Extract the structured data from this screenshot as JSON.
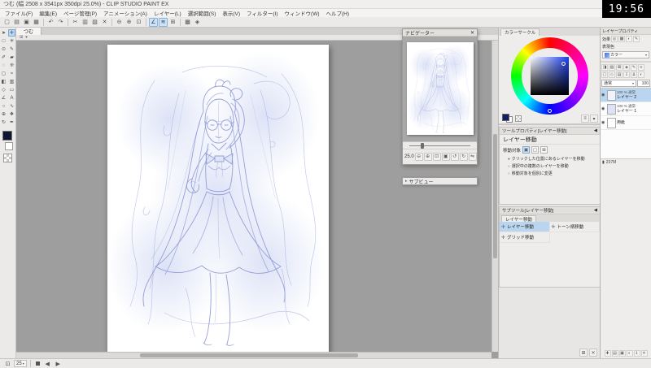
{
  "app": {
    "title": "つむ (幅 2508 x 3541px 350dpi 25.0%) - CLIP STUDIO PAINT EX",
    "clock": "19:56"
  },
  "menu": {
    "items": [
      "ファイル(F)",
      "編集(E)",
      "ページ管理(P)",
      "アニメーション(A)",
      "レイヤー(L)",
      "選択範囲(S)",
      "表示(V)",
      "フィルター(I)",
      "ウィンドウ(W)",
      "ヘルプ(H)"
    ]
  },
  "main_toolbar": {
    "icons": [
      {
        "name": "new-icon",
        "glyph": "▢"
      },
      {
        "name": "open-icon",
        "glyph": "▤"
      },
      {
        "name": "save-icon",
        "glyph": "▣"
      },
      {
        "name": "save-all-icon",
        "glyph": "▦"
      },
      {
        "type": "sep"
      },
      {
        "name": "undo-icon",
        "glyph": "↶"
      },
      {
        "name": "redo-icon",
        "glyph": "↷"
      },
      {
        "type": "sep"
      },
      {
        "name": "cut-icon",
        "glyph": "✂"
      },
      {
        "name": "copy-icon",
        "glyph": "▥"
      },
      {
        "name": "paste-icon",
        "glyph": "▧"
      },
      {
        "name": "delete-icon",
        "glyph": "✕"
      },
      {
        "type": "sep"
      },
      {
        "name": "zoom-out-icon",
        "glyph": "⊖"
      },
      {
        "name": "zoom-in-icon",
        "glyph": "⊕"
      },
      {
        "name": "fit-screen-icon",
        "glyph": "⊡"
      },
      {
        "type": "sep"
      },
      {
        "name": "snap-ruler-icon",
        "glyph": "∠",
        "active": true
      },
      {
        "name": "snap-special-ruler-icon",
        "glyph": "≋",
        "active": true
      },
      {
        "name": "snap-grid-icon",
        "glyph": "⊞"
      },
      {
        "type": "sep"
      },
      {
        "name": "grid-icon",
        "glyph": "▩"
      },
      {
        "name": "material-icon",
        "glyph": "◈"
      }
    ]
  },
  "tool_palette": {
    "foreground_color": "#101630",
    "background_color": "#ffffff",
    "tools": [
      {
        "name": "operation-tool",
        "glyph": "➤"
      },
      {
        "name": "layer-move-tool",
        "glyph": "✛",
        "active": true
      },
      {
        "name": "selection-tool",
        "glyph": "□"
      },
      {
        "name": "auto-select-tool",
        "glyph": "✳"
      },
      {
        "name": "eyedropper-tool",
        "glyph": "⊙"
      },
      {
        "name": "pen-tool",
        "glyph": "✎"
      },
      {
        "name": "pencil-tool",
        "glyph": "✐"
      },
      {
        "name": "brush-tool",
        "glyph": "▰"
      },
      {
        "name": "airbrush-tool",
        "glyph": "◌"
      },
      {
        "name": "decoration-tool",
        "glyph": "❊"
      },
      {
        "name": "eraser-tool",
        "glyph": "◻"
      },
      {
        "name": "blend-tool",
        "glyph": "≈"
      },
      {
        "name": "fill-tool",
        "glyph": "◧"
      },
      {
        "name": "gradient-tool",
        "glyph": "▥"
      },
      {
        "name": "figure-tool",
        "glyph": "◇"
      },
      {
        "name": "frame-border-tool",
        "glyph": "▭"
      },
      {
        "name": "ruler-tool",
        "glyph": "∠"
      },
      {
        "name": "text-tool",
        "glyph": "A"
      },
      {
        "name": "balloon-tool",
        "glyph": "○"
      },
      {
        "name": "line-correction-tool",
        "glyph": "∿"
      },
      {
        "name": "zoom-tool",
        "glyph": "⊕"
      },
      {
        "name": "move-view-tool",
        "glyph": "❖"
      },
      {
        "name": "rotate-view-tool",
        "glyph": "↻"
      },
      {
        "name": "select-pen-tool",
        "glyph": "✒"
      }
    ]
  },
  "document": {
    "tab_label": "つむ"
  },
  "navigator": {
    "title": "ナビゲーター",
    "zoom_value": "25.0",
    "controls": [
      {
        "name": "nav-zoom-out-icon",
        "glyph": "⊖"
      },
      {
        "name": "nav-zoom-in-icon",
        "glyph": "⊕"
      },
      {
        "name": "nav-fit-icon",
        "glyph": "⊡"
      },
      {
        "name": "nav-actual-size-icon",
        "glyph": "▣"
      },
      {
        "name": "nav-rotate-left-icon",
        "glyph": "↺"
      },
      {
        "name": "nav-rotate-right-icon",
        "glyph": "↻"
      },
      {
        "name": "nav-flip-icon",
        "glyph": "⇋"
      }
    ]
  },
  "subview": {
    "title": "サブビュー"
  },
  "color_panel": {
    "tab_label": "カラーサークル",
    "selected_color": "#131f63",
    "hue_color": "#1c40f2"
  },
  "tool_property": {
    "title": "ツールプロパティ[レイヤー移動]",
    "tool_name": "レイヤー移動",
    "param_label": "移動対象",
    "options": [
      {
        "label": "クリックした位置にあるレイヤーを移動",
        "selected": true
      },
      {
        "label": "選択中の複数のレイヤーを移動",
        "selected": false
      },
      {
        "label": "移動対象を個別に変更",
        "selected": false
      }
    ]
  },
  "sub_tool": {
    "title": "サブツール[レイヤー移動]",
    "group_tab": "レイヤー移動",
    "items": [
      {
        "name": "subtool-layer-move",
        "label": "レイヤー移動",
        "selected": true
      },
      {
        "name": "subtool-tone-move",
        "label": "トーン柄移動",
        "selected": false
      },
      {
        "name": "subtool-grid-move",
        "label": "グリッド移動",
        "selected": false
      }
    ]
  },
  "layer_property": {
    "title": "レイヤープロパティ",
    "effect_label": "効果",
    "effect_icons": [
      {
        "name": "border-effect-icon",
        "glyph": "◎"
      },
      {
        "name": "tone-effect-icon",
        "glyph": "▩"
      },
      {
        "name": "layer-color-effect-icon",
        "glyph": "◐"
      },
      {
        "name": "extract-line-effect-icon",
        "glyph": "✎"
      }
    ],
    "expression_label": "表現色",
    "expression_value": "カラー"
  },
  "layer_panel": {
    "toolbar_row1": [
      {
        "name": "clip-layer-icon",
        "glyph": "◨"
      },
      {
        "name": "lock-pixel-icon",
        "glyph": "▧"
      },
      {
        "name": "lock-layer-icon",
        "glyph": "⊠"
      },
      {
        "name": "reference-layer-icon",
        "glyph": "◈"
      },
      {
        "name": "draft-layer-icon",
        "glyph": "✎"
      },
      {
        "name": "palette-menu-icon",
        "glyph": "≡"
      }
    ],
    "toolbar_row2": [
      {
        "name": "new-raster-layer-icon",
        "glyph": "▢"
      },
      {
        "name": "new-vector-layer-icon",
        "glyph": "◇"
      },
      {
        "name": "new-folder-icon",
        "glyph": "▤"
      },
      {
        "name": "transfer-down-icon",
        "glyph": "⇩"
      },
      {
        "name": "merge-down-icon",
        "glyph": "⇊"
      },
      {
        "name": "layer-mask-icon",
        "glyph": "◐"
      }
    ],
    "blend_mode": "通常",
    "opacity_value": "100",
    "layers": [
      {
        "opacity": "100 %",
        "mode": "通常",
        "layer_name": "レイヤー 2",
        "selected": true,
        "thumb": "#f0f3fc",
        "visible": true
      },
      {
        "opacity": "100 %",
        "mode": "通常",
        "layer_name": "レイヤー 1",
        "selected": false,
        "thumb": "#dce3f7",
        "visible": true
      },
      {
        "opacity": "",
        "mode": "",
        "layer_name": "用紙",
        "selected": false,
        "thumb": "#ffffff",
        "visible": true
      }
    ],
    "memory_text": "237M",
    "footer_icons": [
      {
        "name": "footer-new-layer-icon",
        "glyph": "✚"
      },
      {
        "name": "footer-new-folder-icon",
        "glyph": "▤"
      },
      {
        "name": "footer-duplicate-icon",
        "glyph": "▣"
      },
      {
        "name": "footer-mask-icon",
        "glyph": "◐"
      },
      {
        "name": "footer-apply-mask-icon",
        "glyph": "⇓"
      },
      {
        "name": "footer-delete-icon",
        "glyph": "✕"
      }
    ]
  },
  "status_bar": {
    "zoom_value": "25"
  }
}
